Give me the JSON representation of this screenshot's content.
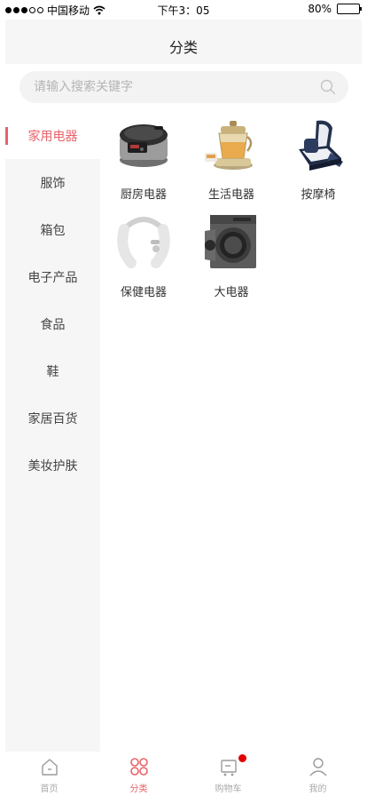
{
  "status_bar": {
    "carrier": "中国移动",
    "time": "下午3：05",
    "battery": "80%",
    "battery_level": 0.8
  },
  "header": {
    "title": "分类"
  },
  "search": {
    "placeholder": "请输入搜索关键字",
    "value": ""
  },
  "sidebar": {
    "active_index": 0,
    "items": [
      {
        "label": "家用电器"
      },
      {
        "label": "服饰"
      },
      {
        "label": "箱包"
      },
      {
        "label": "电子产品"
      },
      {
        "label": "食品"
      },
      {
        "label": "鞋"
      },
      {
        "label": "家居百货"
      },
      {
        "label": "美妆护肤"
      }
    ]
  },
  "categories": [
    {
      "label": "厨房电器",
      "icon": "rice-cooker-icon"
    },
    {
      "label": "生活电器",
      "icon": "health-pot-icon"
    },
    {
      "label": "按摩椅",
      "icon": "massage-chair-icon"
    },
    {
      "label": "保健电器",
      "icon": "neck-massager-icon"
    },
    {
      "label": "大电器",
      "icon": "washing-machine-icon"
    }
  ],
  "tabbar": {
    "active_index": 1,
    "items": [
      {
        "label": "首页",
        "icon": "home-icon"
      },
      {
        "label": "分类",
        "icon": "category-icon"
      },
      {
        "label": "购物车",
        "icon": "cart-icon"
      },
      {
        "label": "我的",
        "icon": "user-icon"
      }
    ]
  },
  "colors": {
    "accent": "#e8626a",
    "badge": "#e00000",
    "sidebar_bg": "#f6f6f6"
  }
}
